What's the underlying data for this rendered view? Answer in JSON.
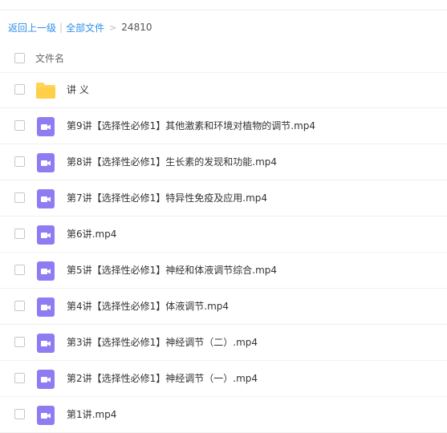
{
  "breadcrumb": {
    "back_label": "返回上一级",
    "separator": "|",
    "all_files_label": "全部文件",
    "arrow": ">",
    "current_folder": "24810"
  },
  "list": {
    "header_label": "文件名",
    "items": [
      {
        "name": "讲 义",
        "type": "folder"
      },
      {
        "name": "第9讲【选择性必修1】其他激素和环境对植物的调节.mp4",
        "type": "video"
      },
      {
        "name": "第8讲【选择性必修1】生长素的发现和功能.mp4",
        "type": "video"
      },
      {
        "name": "第7讲【选择性必修1】特异性免疫及应用.mp4",
        "type": "video"
      },
      {
        "name": "第6讲.mp4",
        "type": "video"
      },
      {
        "name": "第5讲【选择性必修1】神经和体液调节综合.mp4",
        "type": "video"
      },
      {
        "name": "第4讲【选择性必修1】体液调节.mp4",
        "type": "video"
      },
      {
        "name": "第3讲【选择性必修1】神经调节（二）.mp4",
        "type": "video"
      },
      {
        "name": "第2讲【选择性必修1】神经调节（一）.mp4",
        "type": "video"
      },
      {
        "name": "第1讲.mp4",
        "type": "video"
      }
    ]
  },
  "colors": {
    "link": "#2f8fe8",
    "folder": "#ffd35c",
    "video": "#8f7cf2"
  }
}
